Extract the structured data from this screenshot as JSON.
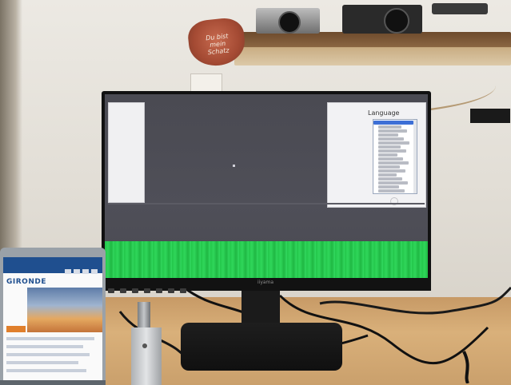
{
  "monitor": {
    "language_window": {
      "title": "Language",
      "selected_index": 0,
      "item_count": 20
    },
    "brand_text": "iiyama"
  },
  "laptop": {
    "page_title": "GIRONDE"
  },
  "decor": {
    "heart_text": "Du bist mein Schatz"
  },
  "colors": {
    "desktop_bg": "#4a4a52",
    "green_band": "#2fd65a",
    "selection": "#3d6fd6",
    "desk_wood": "#d9b07a"
  }
}
